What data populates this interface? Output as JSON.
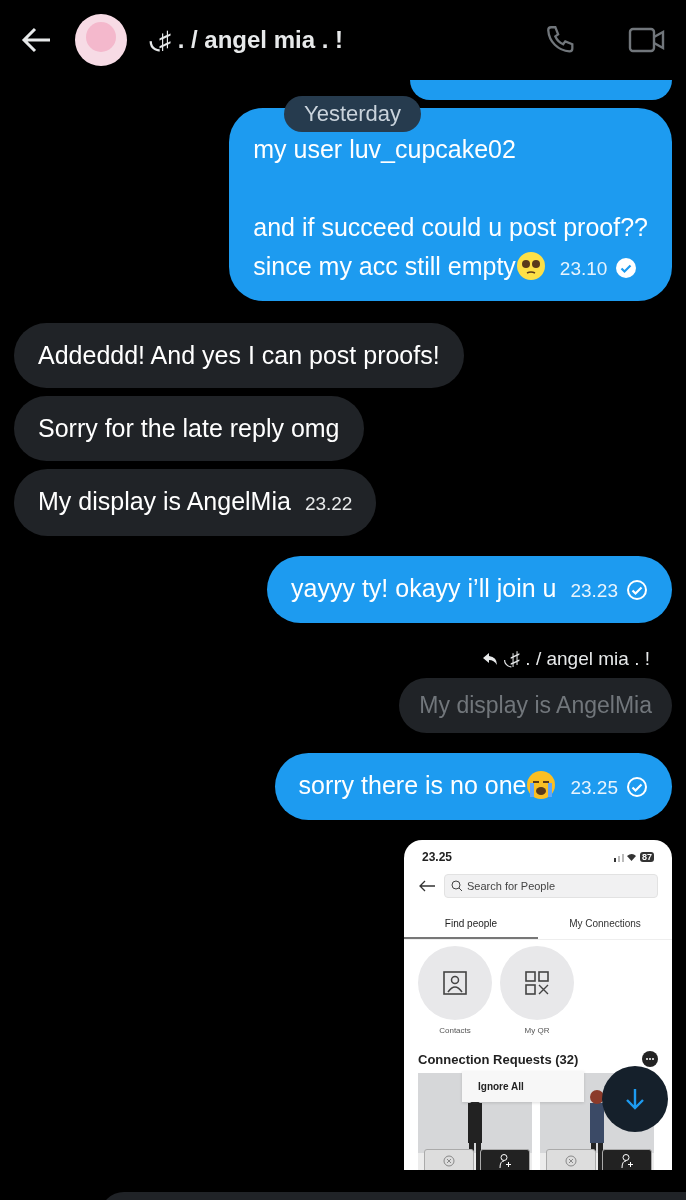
{
  "header": {
    "title": "◟♯ . / angel mia . !"
  },
  "date_divider": "Yesterday",
  "messages": [
    {
      "kind": "sent_fragment"
    },
    {
      "kind": "sent",
      "paragraphs": [
        [
          "my user luv_cupcake02"
        ],
        [
          "and if succeed could u post proof??",
          "since my acc still empty"
        ]
      ],
      "emoji": true,
      "time": "23.10",
      "read": true
    },
    {
      "kind": "received",
      "paragraphs": [
        [
          "Addeddd! And yes I can post proofs!"
        ]
      ]
    },
    {
      "kind": "received",
      "paragraphs": [
        [
          "Sorry for the late reply omg"
        ]
      ]
    },
    {
      "kind": "received",
      "paragraphs": [
        [
          "My display is AngelMia"
        ]
      ],
      "time": "23.22"
    },
    {
      "kind": "sent",
      "paragraphs": [
        [
          "yayyy ty! okayy i’ll join u"
        ]
      ],
      "time": "23.23",
      "read": false
    },
    {
      "kind": "reply_label",
      "text": "◟♯ . / angel mia . !"
    },
    {
      "kind": "quote",
      "text": "My display is AngelMia"
    },
    {
      "kind": "sent",
      "paragraphs": [
        [
          "sorry there is no one"
        ]
      ],
      "emoji": true,
      "time": "23.25",
      "read": false
    },
    {
      "kind": "screenshot",
      "status_time": "23.25",
      "battery": "87",
      "search_placeholder": "Search for People",
      "tabs": [
        {
          "label": "Find people",
          "selected": true
        },
        {
          "label": "My Connections",
          "selected": false
        }
      ],
      "shortcuts": [
        {
          "label": "Contacts"
        },
        {
          "label": "My QR"
        }
      ],
      "section_title": "Connection Requests (32)",
      "menu_item": "Ignore All"
    }
  ]
}
